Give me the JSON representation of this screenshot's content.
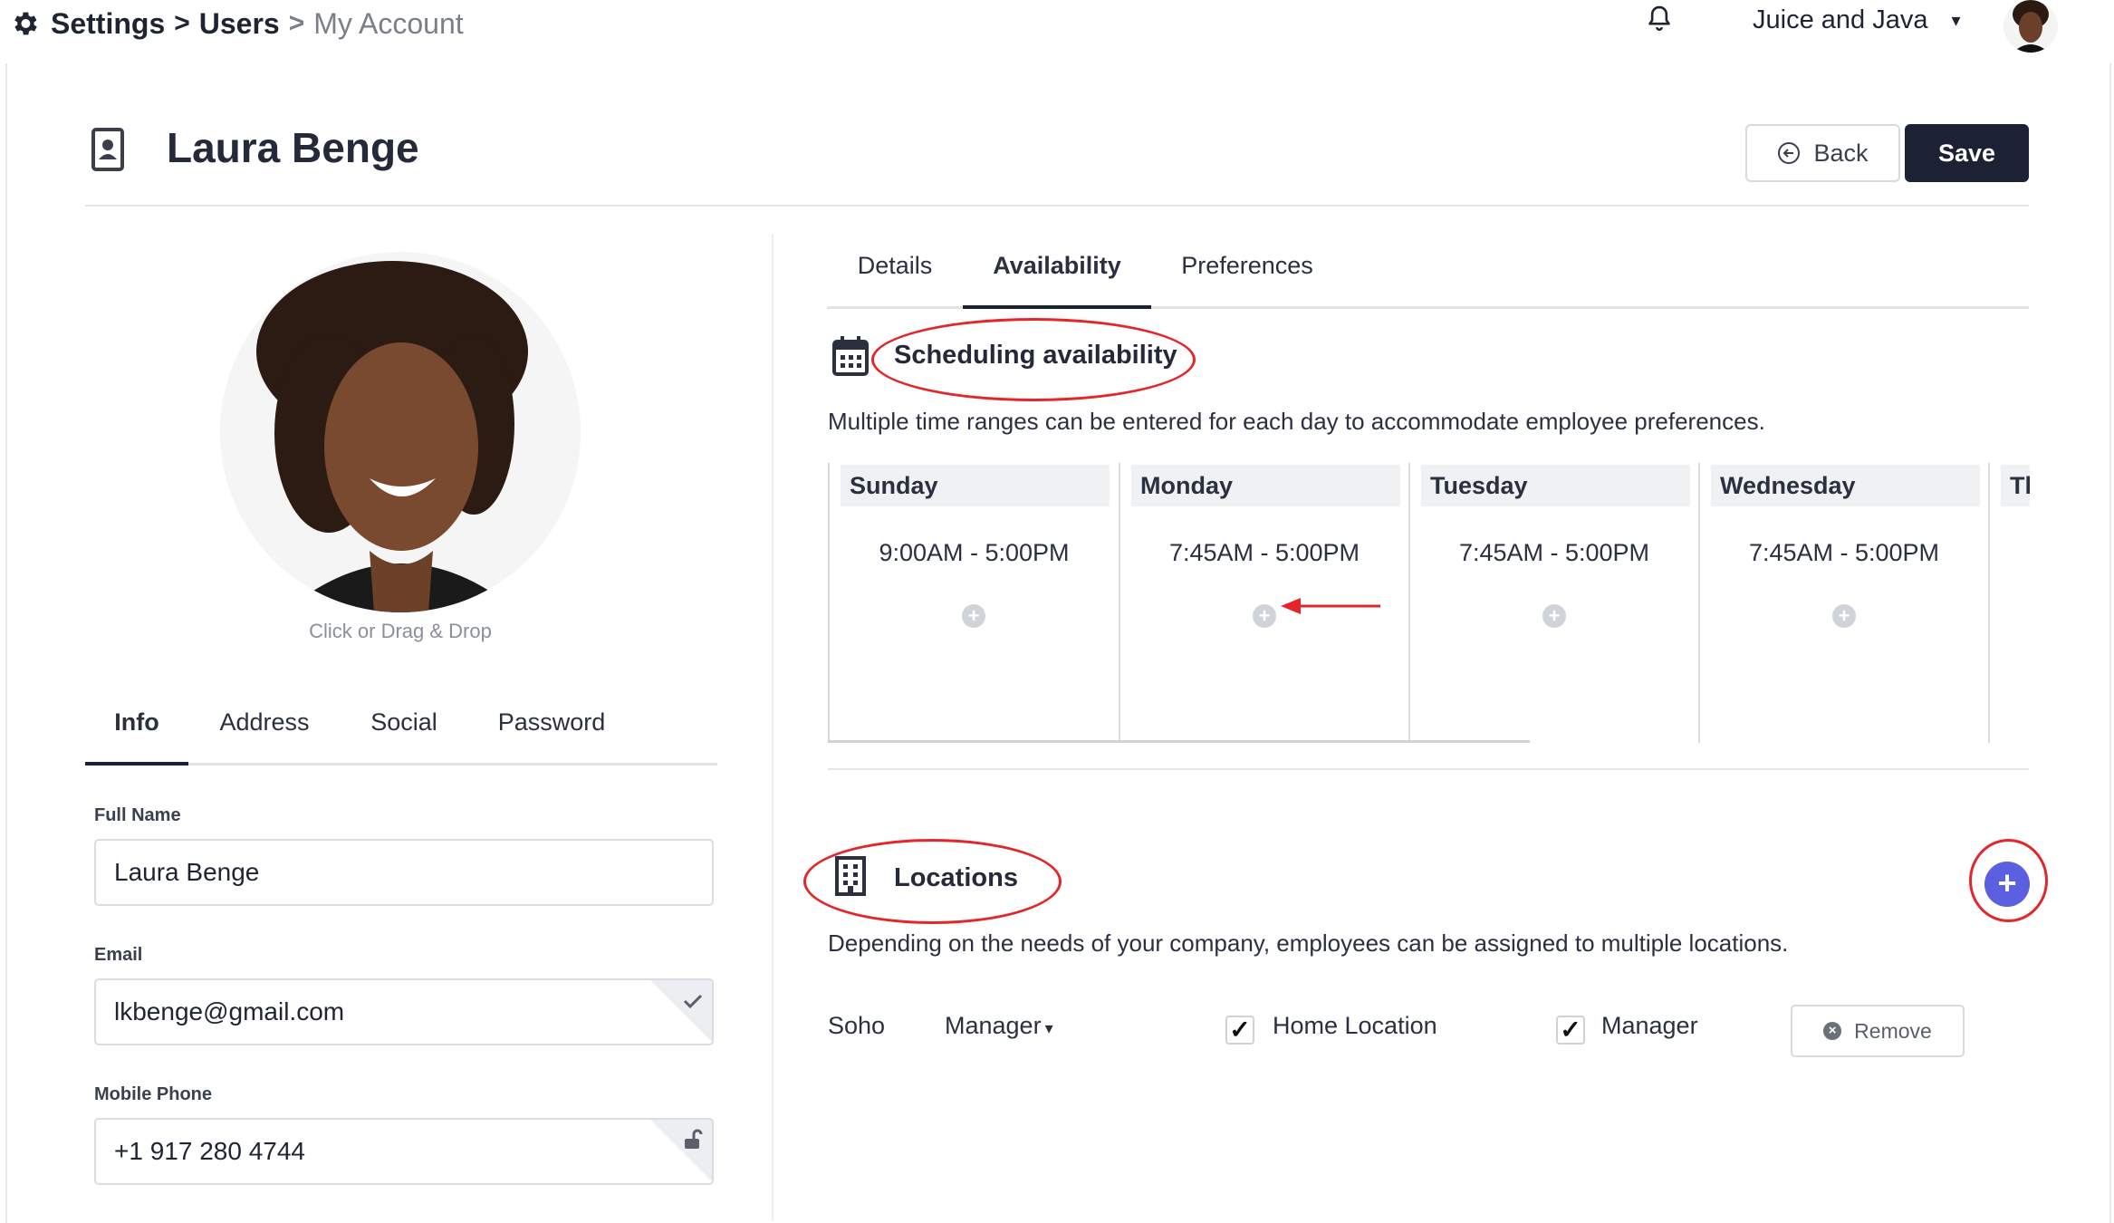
{
  "breadcrumb": {
    "settings": "Settings",
    "users": "Users",
    "current": "My Account",
    "separator": ">"
  },
  "header": {
    "organization": "Juice and Java",
    "org_caret": "▾",
    "bell_icon": "bell-icon",
    "gear_icon": "gear-icon"
  },
  "page": {
    "title": "Laura Benge",
    "back_label": "Back",
    "save_label": "Save"
  },
  "profile": {
    "photo_hint": "Click or Drag & Drop"
  },
  "left_tabs": [
    "Info",
    "Address",
    "Social",
    "Password"
  ],
  "info": {
    "full_name_label": "Full Name",
    "full_name_value": "Laura Benge",
    "email_label": "Email",
    "email_value": "lkbenge@gmail.com",
    "phone_label": "Mobile Phone",
    "phone_value": "+1 917 280 4744"
  },
  "right_tabs": [
    "Details",
    "Availability",
    "Preferences"
  ],
  "availability": {
    "title": "Scheduling availability",
    "description": "Multiple time ranges can be entered for each day to accommodate employee preferences.",
    "days": [
      {
        "name": "Sunday",
        "range": "9:00AM - 5:00PM"
      },
      {
        "name": "Monday",
        "range": "7:45AM - 5:00PM"
      },
      {
        "name": "Tuesday",
        "range": "7:45AM - 5:00PM"
      },
      {
        "name": "Wednesday",
        "range": "7:45AM - 5:00PM"
      },
      {
        "name": "Th",
        "range": ""
      }
    ],
    "add_symbol": "+"
  },
  "locations": {
    "title": "Locations",
    "description": "Depending on the needs of your company, employees can be assigned to multiple locations.",
    "add_symbol": "+",
    "rows": [
      {
        "location": "Soho",
        "role": "Manager",
        "home_label": "Home Location",
        "home_checked": true,
        "manager_label": "Manager",
        "manager_checked": true,
        "remove_label": "Remove"
      }
    ]
  },
  "annotation_color": "#e3262a",
  "accent_color": "#5b5fe0"
}
